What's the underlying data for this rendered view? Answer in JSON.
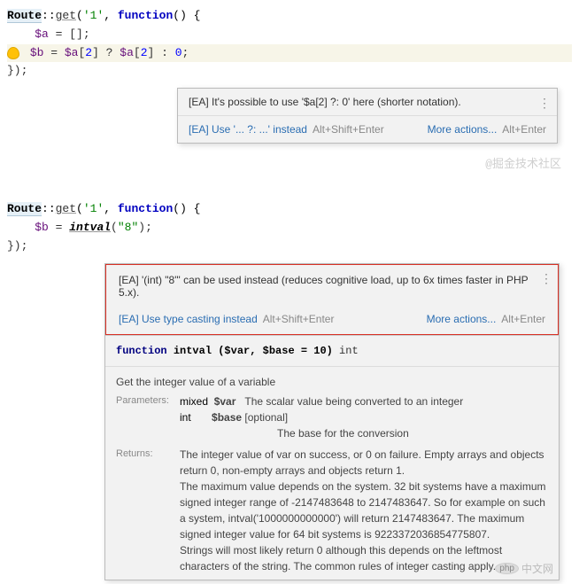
{
  "code1": {
    "route": "Route",
    "get": "get",
    "arg": "'1'",
    "function": "function",
    "line1": "::",
    "line1b": "(",
    "line1c": ", ",
    "line1d": "() {",
    "line2_indent": "    ",
    "line2_var_a": "$a",
    "line2_rest": " = [];",
    "line3_var_b": "$b",
    "line3_eq": " = ",
    "line3_expr_a1": "$a",
    "line3_br1": "[",
    "line3_idx": "2",
    "line3_br2": "]",
    "line3_q": " ? ",
    "line3_a2": "$a",
    "line3_br3": "[",
    "line3_idx2": "2",
    "line3_br4": "]",
    "line3_colon": " : ",
    "line3_zero": "0",
    "line3_semi": ";",
    "line4": "});"
  },
  "popup1": {
    "msg": "[EA] It's possible to use '$a[2] ?: 0' here (shorter notation).",
    "action": "[EA] Use '... ?: ...' instead",
    "shortcut1": "Alt+Shift+Enter",
    "more": "More actions...",
    "shortcut2": "Alt+Enter"
  },
  "watermark1": "@掘金技术社区",
  "code2": {
    "route": "Route",
    "get": "get",
    "arg": "'1'",
    "function": "function",
    "line1d": "() {",
    "line2_var_b": "$b",
    "line2_eq": " = ",
    "line2_fn": "intval",
    "line2_arg": "\"8\"",
    "line2_close": ");",
    "line3": "});"
  },
  "popup2": {
    "msg": "[EA] '(int) \"8\"' can be used instead (reduces cognitive load, up to 6x times faster in PHP 5.x).",
    "action": "[EA] Use type casting instead",
    "shortcut1": "Alt+Shift+Enter",
    "more": "More actions...",
    "shortcut2": "Alt+Enter"
  },
  "doc": {
    "sig_kw": "function",
    "sig_name": "intval",
    "sig_params": " ($var, $base = 10)",
    "sig_ret": " int",
    "summary": "Get the integer value of a variable",
    "params_label": "Parameters:",
    "p1_type": "mixed",
    "p1_name": "$var",
    "p1_desc": "The scalar value being converted to an integer",
    "p2_type": "int",
    "p2_name": "$base",
    "p2_opt": "[optional]",
    "p2_desc": "The base for the conversion",
    "returns_label": "Returns:",
    "returns_text": "The integer value of var on success, or 0 on failure. Empty arrays and objects return 0, non-empty arrays and objects return 1.\nThe maximum value depends on the system. 32 bit systems have a maximum signed integer range of -2147483648 to 2147483647. So for example on such a system, intval('1000000000000') will return 2147483647. The maximum signed integer value for 64 bit systems is 9223372036854775807.\nStrings will most likely return 0 although this depends on the leftmost characters of the string. The common rules of integer casting apply."
  },
  "logo": {
    "php": "php",
    "cn": "中文网"
  }
}
